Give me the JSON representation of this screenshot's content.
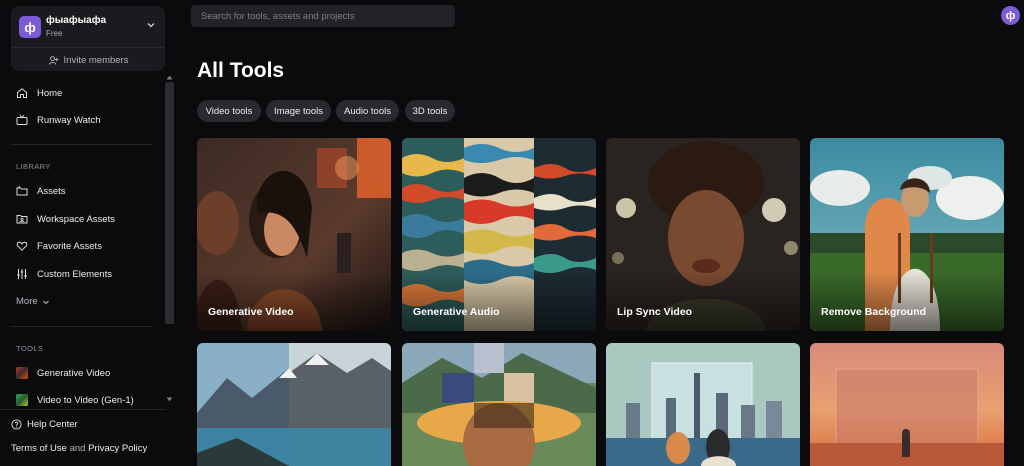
{
  "workspace": {
    "avatar_letter": "ф",
    "name": "фыафыафа",
    "plan": "Free",
    "invite_label": "Invite members"
  },
  "nav": {
    "home": "Home",
    "runway_watch": "Runway Watch"
  },
  "library": {
    "title": "LIBRARY",
    "items": [
      "Assets",
      "Workspace Assets",
      "Favorite Assets",
      "Custom Elements"
    ],
    "more": "More"
  },
  "tools_section": {
    "title": "TOOLS",
    "items": [
      "Generative Video",
      "Video to Video (Gen-1)"
    ]
  },
  "footer": {
    "help": "Help Center",
    "terms": "Terms of Use",
    "and": "and",
    "privacy": "Privacy Policy"
  },
  "search": {
    "placeholder": "Search for tools, assets and projects"
  },
  "user": {
    "avatar_letter": "ф"
  },
  "main": {
    "title": "All Tools",
    "filters": [
      "Video tools",
      "Image tools",
      "Audio tools",
      "3D tools"
    ],
    "cards": [
      "Generative Video",
      "Generative Audio",
      "Lip Sync Video",
      "Remove Background"
    ]
  },
  "colors": {
    "accent": "#7b5cd6",
    "background": "#0b0b0d",
    "chip": "#2a2a2e",
    "card_surface": "#1b1b1f"
  }
}
